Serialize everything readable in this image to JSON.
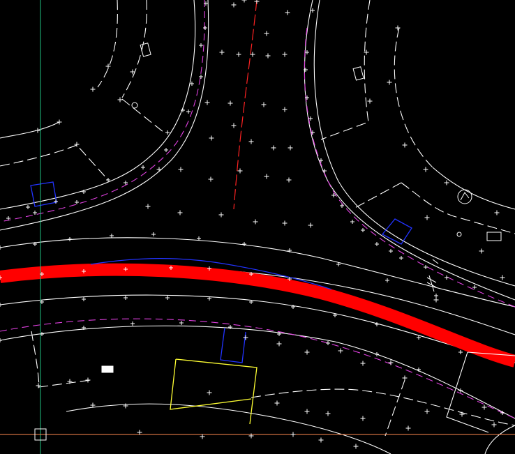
{
  "viewport": {
    "background": "#000000",
    "ucs_icon": "ucs-crosshair-icon"
  },
  "layer_colors": {
    "road_edge": "#ffffff",
    "easement": "#e040e0",
    "centerline_main": "#ff0000",
    "centerline_branch": "#ff2222",
    "parcel_blue": "#2233ff",
    "parcel_yellow": "#ffff33",
    "crosshair_vertical": "#20c080",
    "crosshair_horizontal": "#ff8a50"
  },
  "symbols": [
    "north-arrow-symbol",
    "hatch-box-symbol",
    "hydrant-symbol",
    "survey-point-symbol",
    "grid-point-symbol"
  ]
}
